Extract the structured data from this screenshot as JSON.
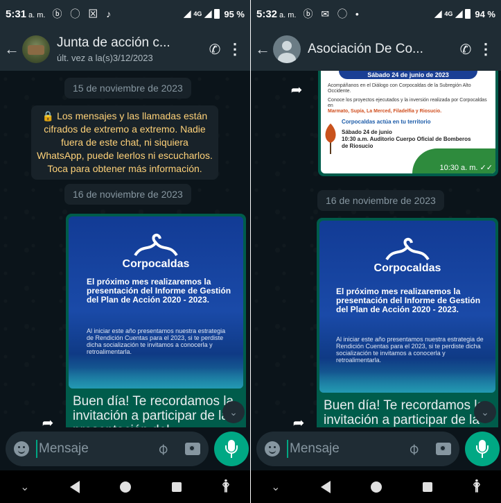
{
  "left": {
    "status": {
      "time": "5:31",
      "ampm": "a. m.",
      "battery": "95 %",
      "notif_icons": "ⓑ ◯ ⊠ ♪",
      "net": "4G"
    },
    "header": {
      "title": "Junta de acción c...",
      "subtitle": "últ. vez a la(s)3/12/2023"
    },
    "date1": "15 de noviembre de 2023",
    "encryption": "🔒 Los mensajes y las llamadas están cifrados de extremo a extremo. Nadie fuera de este chat, ni siquiera WhatsApp, puede leerlos ni escucharlos. Toca para obtener más información.",
    "date2": "16 de noviembre de 2023",
    "poster": {
      "brand": "Corpocaldas",
      "headline": "El próximo mes realizaremos la presentación del Informe de Gestión del Plan de Acción 2020 - 2023.",
      "body": "Al iniciar este año presentamos nuestra estrategia de Rendición Cuentas para el 2023, si te perdiste dicha socialización te invitamos a conocerla y retroalimentarla."
    },
    "caption": "Buen día! Te recordamos la invitación a participar de la presentación del"
  },
  "right": {
    "status": {
      "time": "5:32",
      "ampm": "a. m.",
      "battery": "94 %",
      "notif_icons": "ⓑ ✉ ◯ •",
      "net": "4G"
    },
    "header": {
      "title": "Asociación De Co..."
    },
    "event": {
      "banner": "Sábado 24 de junio de 2023",
      "line1": "Acompáñanos en el Diálogo con Corpocaldas de la Subregión Alto Occidente.",
      "line2": "Conoce los proyectos ejecutados y la inversión realizada por Corpocaldas en",
      "places": "Marmato, Supía, La Merced, Filadelfia y Riosucio.",
      "tagline": "Corpocaldas actúa en tu territorio",
      "when": "Sábado 24 de junio",
      "where": "10:30 a.m. Auditorio Cuerpo Oficial de Bomberos de Riosucio",
      "time_meta": "10:30 a. m."
    },
    "date2": "16 de noviembre de 2023",
    "poster": {
      "brand": "Corpocaldas",
      "headline": "El próximo mes realizaremos la presentación del Informe de Gestión del Plan de Acción 2020 - 2023.",
      "body": "Al iniciar este año presentamos nuestra estrategia de Rendición Cuentas para el 2023, si te perdiste dicha socialización te invitamos a conocerla y retroalimentarla."
    },
    "caption": "Buen día! Te recordamos la invitación a participar de la presentación del"
  },
  "composer": {
    "placeholder": "Mensaje"
  },
  "colors": {
    "accent": "#00a884",
    "bubble_out": "#005c4b",
    "bar": "#1f2c34",
    "chat_bg": "#0b141a",
    "enc_text": "#ffd279"
  },
  "icons": [
    "back-arrow-icon",
    "add-call-icon",
    "overflow-menu-icon",
    "forward-icon",
    "scroll-down-icon",
    "emoji-icon",
    "attach-icon",
    "camera-icon",
    "mic-icon",
    "lock-icon"
  ]
}
